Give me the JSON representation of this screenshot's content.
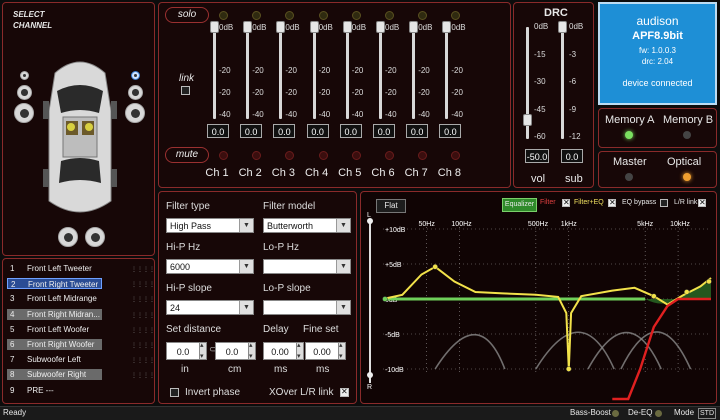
{
  "select_channel": {
    "title_line1": "SELECT",
    "title_line2": "CHANNEL"
  },
  "channel_list": [
    {
      "num": "1",
      "name": "Front Left Tweeter",
      "selected": false
    },
    {
      "num": "2",
      "name": "Front Right Tweeter",
      "selected": true
    },
    {
      "num": "3",
      "name": "Front Left Midrange",
      "selected": false
    },
    {
      "num": "4",
      "name": "Front Right Midran...",
      "selected": false
    },
    {
      "num": "5",
      "name": "Front Left Woofer",
      "selected": false
    },
    {
      "num": "6",
      "name": "Front Right Woofer",
      "selected": false
    },
    {
      "num": "7",
      "name": "Subwoofer Left",
      "selected": false
    },
    {
      "num": "8",
      "name": "Subwoofer Right",
      "selected": false
    },
    {
      "num": "9",
      "name": "PRE ---",
      "selected": false
    }
  ],
  "mixer": {
    "solo_label": "solo",
    "link_label": "link",
    "mute_label": "mute",
    "ticks": [
      "0dB",
      "-20",
      "-20",
      "-40"
    ],
    "channels": [
      {
        "label": "Ch 1",
        "value": "0.0",
        "level_db": 0
      },
      {
        "label": "Ch 2",
        "value": "0.0",
        "level_db": 0
      },
      {
        "label": "Ch 3",
        "value": "0.0",
        "level_db": 0
      },
      {
        "label": "Ch 4",
        "value": "0.0",
        "level_db": 0
      },
      {
        "label": "Ch 5",
        "value": "0.0",
        "level_db": 0
      },
      {
        "label": "Ch 6",
        "value": "0.0",
        "level_db": 0
      },
      {
        "label": "Ch 7",
        "value": "0.0",
        "level_db": 0
      },
      {
        "label": "Ch 8",
        "value": "0.0",
        "level_db": 0
      }
    ]
  },
  "drc": {
    "title": "DRC",
    "vol_ticks": [
      "0dB",
      "-15",
      "-30",
      "-45",
      "-60"
    ],
    "sub_ticks": [
      "0dB",
      "-3",
      "-6",
      "-9",
      "-12"
    ],
    "vol_value": "-50.0",
    "sub_value": "0.0",
    "vol_label": "vol",
    "sub_label": "sub",
    "vol_level_db": -50,
    "sub_level_db": 0
  },
  "device": {
    "brand": "audison",
    "model": "APF8.9bit",
    "fw": "fw: 1.0.0.3",
    "drc": "drc: 2.04",
    "status": "device connected",
    "accent_color": "#1e8fd6"
  },
  "memory": {
    "a_label": "Memory A",
    "b_label": "Memory B"
  },
  "mode": {
    "master_label": "Master",
    "optical_label": "Optical"
  },
  "filter": {
    "type_label": "Filter type",
    "type_value": "High Pass",
    "model_label": "Filter model",
    "model_value": "Butterworth",
    "hip_hz_label": "Hi-P Hz",
    "hip_hz_value": "6000",
    "lop_hz_label": "Lo-P Hz",
    "lop_hz_value": "",
    "hip_slope_label": "Hi-P slope",
    "hip_slope_value": "24",
    "lop_slope_label": "Lo-P slope",
    "lop_slope_value": "",
    "set_distance_label": "Set distance",
    "delay_label": "Delay",
    "fine_set_label": "Fine set",
    "dist_in": "0.0",
    "dist_cm": "0.0",
    "delay_value": "0.00",
    "fine_value": "0.00",
    "unit_in": "in",
    "unit_cm": "cm",
    "unit_ms1": "ms",
    "unit_ms2": "ms",
    "invert_phase_label": "Invert phase",
    "xover_label": "XOver L/R link"
  },
  "graph": {
    "flat_label": "Flat",
    "equalizer_label": "Equalizer",
    "filter_label": "Filter",
    "filter_eq_label": "Filter+EQ",
    "eq_bypass_label": "EQ bypass",
    "lr_link_label": "L/R link",
    "freq_labels": [
      "50Hz",
      "100Hz",
      "500Hz",
      "1kHz",
      "5kHz",
      "10kHz"
    ],
    "db_labels": [
      "+10dB",
      "+5dB",
      "0dB",
      "-5dB",
      "-10dB"
    ],
    "l_label": "L",
    "r_label": "R"
  },
  "status_bar": {
    "status": "Ready",
    "bass_boost": "Bass-Boost",
    "de_eq": "De-EQ",
    "mode": "Mode",
    "mode_value": "STD"
  }
}
